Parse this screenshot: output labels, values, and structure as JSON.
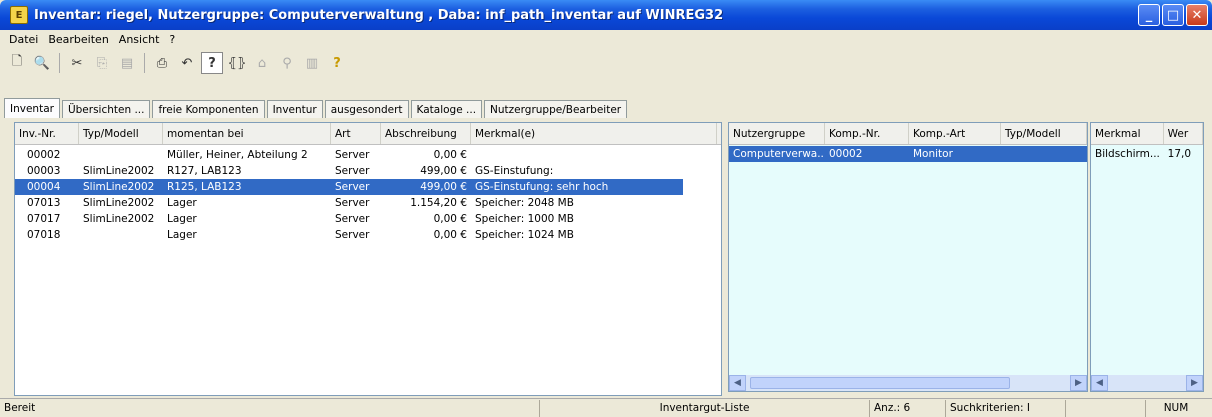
{
  "window": {
    "title": "Inventar: riegel, Nutzergruppe: Computerverwaltung , Daba: inf_path_inventar auf WINREG32",
    "app_icon": "E",
    "controls": [
      "minimize",
      "maximize",
      "close"
    ]
  },
  "menu": [
    "Datei",
    "Bearbeiten",
    "Ansicht",
    "?"
  ],
  "toolbar": {
    "help_label": "?",
    "icons": [
      "new-doc-icon",
      "preview-icon",
      "cut-icon",
      "copy-icon",
      "paste-icon",
      "print-icon",
      "undo-icon",
      "help-icon",
      "bracket-icon",
      "building-icon",
      "search-icon",
      "chart-icon",
      "question-icon"
    ]
  },
  "tabs": [
    "Inventar",
    "Übersichten ...",
    "freie Komponenten",
    "Inventur",
    "ausgesondert",
    "Kataloge ...",
    "Nutzergruppe/Bearbeiter"
  ],
  "inventory": {
    "headers": [
      "Inv.-Nr.",
      "Typ/Modell",
      "momentan bei",
      "Art",
      "Abschreibung",
      "Merkmal(e)"
    ],
    "rows": [
      [
        "00002",
        "",
        "Müller, Heiner, Abteilung 2",
        "Server",
        "0,00 €",
        ""
      ],
      [
        "00003",
        "SlimLine2002",
        "R127, LAB123",
        "Server",
        "499,00 €",
        "GS-Einstufung:"
      ],
      [
        "00004",
        "SlimLine2002",
        "R125, LAB123",
        "Server",
        "499,00 €",
        "GS-Einstufung: sehr hoch"
      ],
      [
        "07013",
        "SlimLine2002",
        "Lager",
        "Server",
        "1.154,20 €",
        "Speicher: 2048 MB"
      ],
      [
        "07017",
        "SlimLine2002",
        "Lager",
        "Server",
        "0,00 €",
        "Speicher: 1000 MB"
      ],
      [
        "07018",
        "",
        "Lager",
        "Server",
        "0,00 €",
        "Speicher: 1024 MB"
      ]
    ],
    "selected_index": 2
  },
  "components": {
    "headers": [
      "Nutzergruppe",
      "Komp.-Nr.",
      "Komp.-Art",
      "Typ/Modell"
    ],
    "rows": [
      [
        "Computerverwa...",
        "00002",
        "Monitor",
        ""
      ]
    ]
  },
  "features": {
    "headers": [
      "Merkmal",
      "Wer"
    ],
    "rows": [
      [
        "Bildschirm...",
        "17,0"
      ]
    ]
  },
  "status": {
    "ready": "Bereit",
    "list": "Inventargut-Liste",
    "count": "Anz.: 6",
    "criteria": "Suchkriterien: I",
    "num": "NUM"
  },
  "colors": {
    "selection": "#316ac5",
    "detail_background": "#e6fcfc",
    "titlebar": "#0a48d8"
  }
}
